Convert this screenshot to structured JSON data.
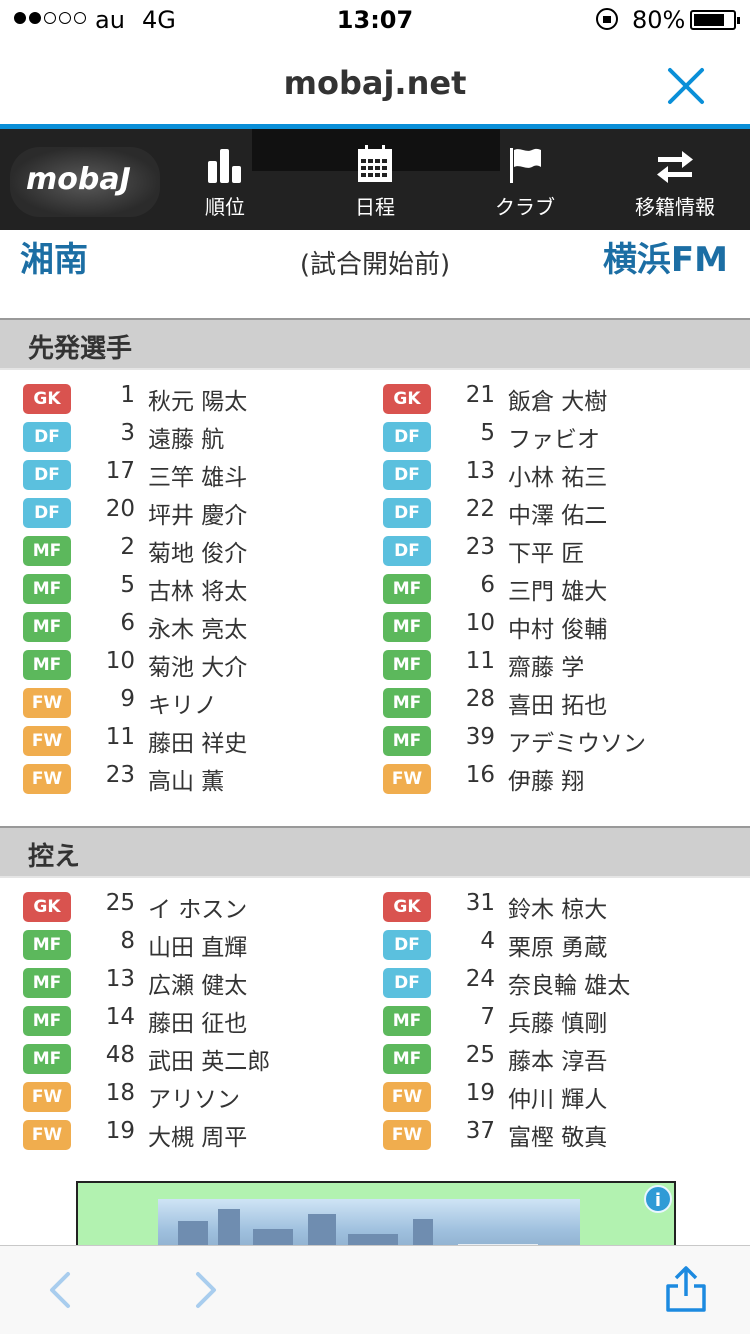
{
  "status_bar": {
    "signal_dots": [
      true,
      true,
      false,
      false,
      false
    ],
    "carrier": "au",
    "network": "4G",
    "time": "13:07",
    "battery_percent": "80%",
    "battery_level": 0.8
  },
  "browser": {
    "url": "mobaj.net",
    "close_icon": "close-icon",
    "accent_color": "#0a8fd8"
  },
  "site_nav": {
    "logo": "mobaJ",
    "items": [
      {
        "label": "順位",
        "icon": "bar-chart-icon"
      },
      {
        "label": "日程",
        "icon": "calendar-icon"
      },
      {
        "label": "クラブ",
        "icon": "flag-icon"
      },
      {
        "label": "移籍情報",
        "icon": "transfer-arrows-icon"
      }
    ]
  },
  "match": {
    "home_team": "湘南",
    "status": "(試合開始前)",
    "away_team": "横浜FM",
    "team_color": "#1c6ea4"
  },
  "position_colors": {
    "GK": "#d9534f",
    "DF": "#5bc0de",
    "MF": "#5cb85c",
    "FW": "#f0ad4e"
  },
  "starters": {
    "title": "先発選手",
    "home": [
      {
        "pos": "GK",
        "num": "1",
        "name": "秋元 陽太"
      },
      {
        "pos": "DF",
        "num": "3",
        "name": "遠藤 航"
      },
      {
        "pos": "DF",
        "num": "17",
        "name": "三竿 雄斗"
      },
      {
        "pos": "DF",
        "num": "20",
        "name": "坪井 慶介"
      },
      {
        "pos": "MF",
        "num": "2",
        "name": "菊地 俊介"
      },
      {
        "pos": "MF",
        "num": "5",
        "name": "古林 将太"
      },
      {
        "pos": "MF",
        "num": "6",
        "name": "永木 亮太"
      },
      {
        "pos": "MF",
        "num": "10",
        "name": "菊池 大介"
      },
      {
        "pos": "FW",
        "num": "9",
        "name": "キリノ"
      },
      {
        "pos": "FW",
        "num": "11",
        "name": "藤田 祥史"
      },
      {
        "pos": "FW",
        "num": "23",
        "name": "高山 薫"
      }
    ],
    "away": [
      {
        "pos": "GK",
        "num": "21",
        "name": "飯倉 大樹"
      },
      {
        "pos": "DF",
        "num": "5",
        "name": "ファビオ"
      },
      {
        "pos": "DF",
        "num": "13",
        "name": "小林 祐三"
      },
      {
        "pos": "DF",
        "num": "22",
        "name": "中澤 佑二"
      },
      {
        "pos": "DF",
        "num": "23",
        "name": "下平 匠"
      },
      {
        "pos": "MF",
        "num": "6",
        "name": "三門 雄大"
      },
      {
        "pos": "MF",
        "num": "10",
        "name": "中村 俊輔"
      },
      {
        "pos": "MF",
        "num": "11",
        "name": "齋藤 学"
      },
      {
        "pos": "MF",
        "num": "28",
        "name": "喜田 拓也"
      },
      {
        "pos": "MF",
        "num": "39",
        "name": "アデミウソン"
      },
      {
        "pos": "FW",
        "num": "16",
        "name": "伊藤 翔"
      }
    ]
  },
  "subs": {
    "title": "控え",
    "home": [
      {
        "pos": "GK",
        "num": "25",
        "name": "イ ホスン"
      },
      {
        "pos": "MF",
        "num": "8",
        "name": "山田 直輝"
      },
      {
        "pos": "MF",
        "num": "13",
        "name": "広瀬 健太"
      },
      {
        "pos": "MF",
        "num": "14",
        "name": "藤田 征也"
      },
      {
        "pos": "MF",
        "num": "48",
        "name": "武田 英二郎"
      },
      {
        "pos": "FW",
        "num": "18",
        "name": "アリソン"
      },
      {
        "pos": "FW",
        "num": "19",
        "name": "大槻 周平"
      }
    ],
    "away": [
      {
        "pos": "GK",
        "num": "31",
        "name": "鈴木 椋大"
      },
      {
        "pos": "DF",
        "num": "4",
        "name": "栗原 勇蔵"
      },
      {
        "pos": "DF",
        "num": "24",
        "name": "奈良輪 雄太"
      },
      {
        "pos": "MF",
        "num": "7",
        "name": "兵藤 慎剛"
      },
      {
        "pos": "MF",
        "num": "25",
        "name": "藤本 淳吾"
      },
      {
        "pos": "FW",
        "num": "19",
        "name": "仲川 輝人"
      },
      {
        "pos": "FW",
        "num": "37",
        "name": "富樫 敬真"
      }
    ]
  },
  "ad": {
    "info_icon": "info-icon",
    "info_label": "i"
  },
  "toolbar": {
    "back_icon": "back-chevron-icon",
    "forward_icon": "forward-chevron-icon",
    "share_icon": "share-icon"
  }
}
